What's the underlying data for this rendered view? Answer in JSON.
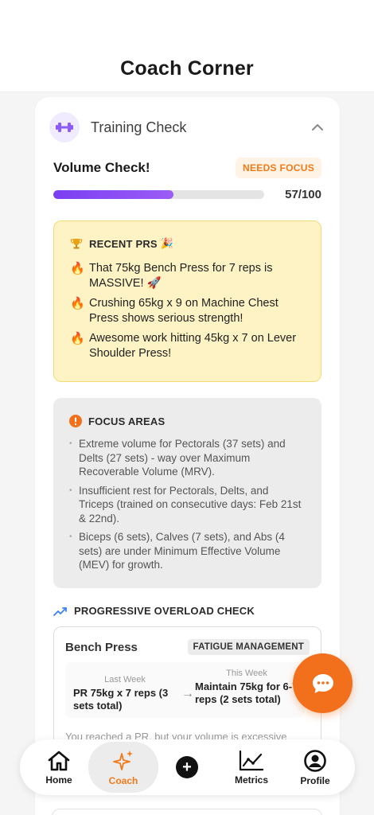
{
  "header": {
    "title": "Coach Corner"
  },
  "training_check": {
    "title": "Training Check",
    "volume": {
      "title": "Volume Check!",
      "badge": "NEEDS FOCUS",
      "progress_value": 57,
      "progress_max": 100,
      "score_label": "57/100"
    }
  },
  "recent_prs": {
    "heading": "RECENT PRS",
    "heading_emoji": "🎉",
    "items": [
      "That 75kg Bench Press for 7 reps is MASSIVE! 🚀",
      "Crushing 65kg x 9 on Machine Chest Press shows serious strength!",
      "Awesome work hitting 45kg x 7 on Lever Shoulder Press!"
    ]
  },
  "focus_areas": {
    "heading": "FOCUS AREAS",
    "items": [
      "Extreme volume for Pectorals (37 sets) and Delts (27 sets) - way over Maximum Recoverable Volume (MRV).",
      "Insufficient rest for Pectorals, Delts, and Triceps (trained on consecutive days: Feb 21st & 22nd).",
      "Biceps (6 sets), Calves (7 sets), and Abs (4 sets) are under Minimum Effective Volume (MEV) for growth."
    ]
  },
  "overload": {
    "heading": "PROGRESSIVE OVERLOAD CHECK",
    "exercise": {
      "name": "Bench Press",
      "badge": "FATIGUE MANAGEMENT",
      "last_week_label": "Last Week",
      "last_week_value": "PR 75kg x 7 reps (3 sets total)",
      "this_week_label": "This Week",
      "this_week_value": "Maintain 75kg for 6-7 reps (2 sets total)",
      "note": "You reached a PR, but your volume is excessive"
    }
  },
  "nav": {
    "home": "Home",
    "coach": "Coach",
    "metrics": "Metrics",
    "profile": "Profile"
  },
  "colors": {
    "accent": "#f2701c",
    "purple": "#7b3ff2",
    "prs_bg": "#fdf3c4"
  }
}
